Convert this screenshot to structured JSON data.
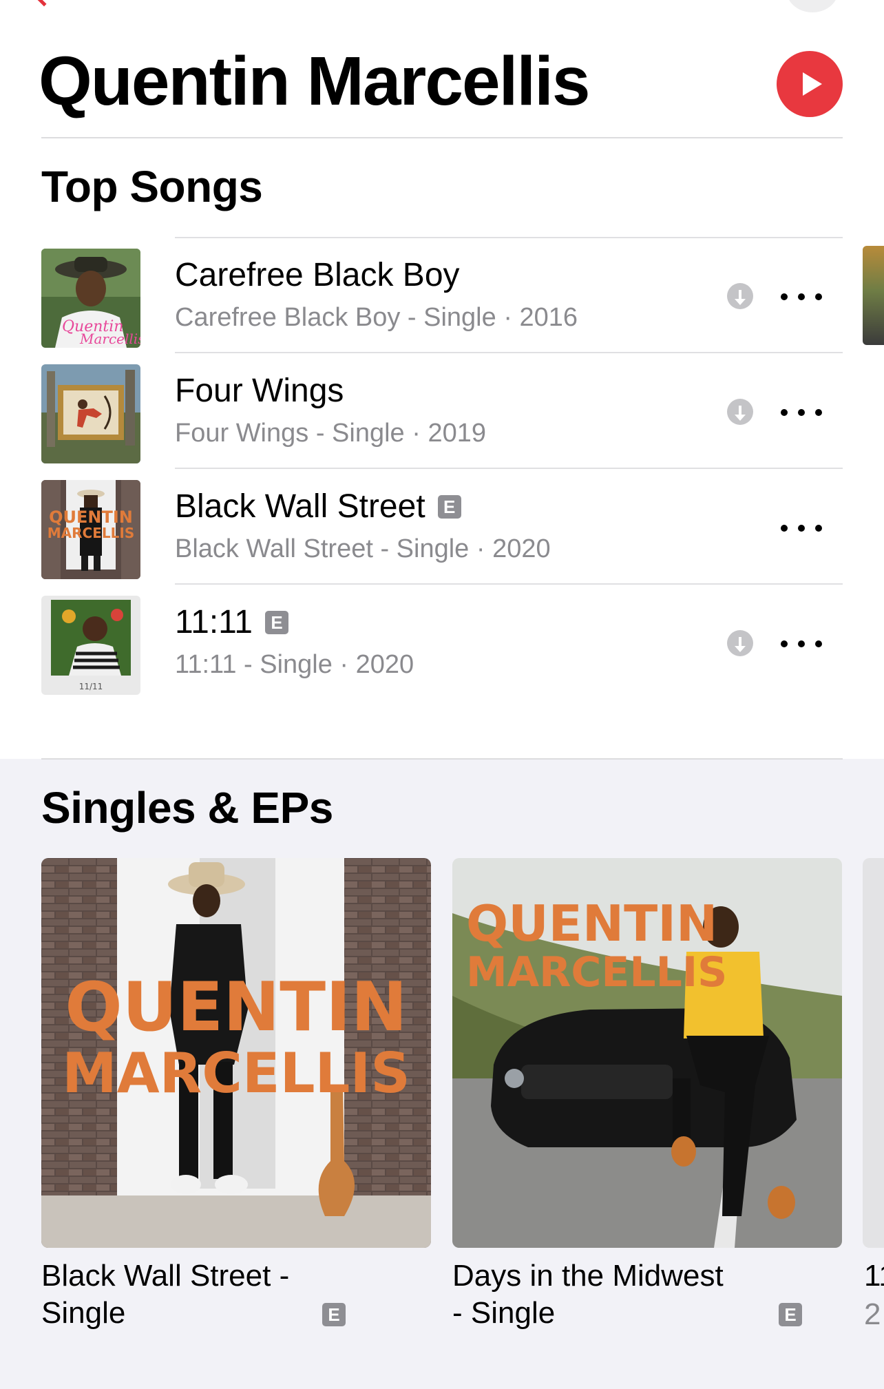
{
  "header": {
    "artist_name": "Quentin Marcellis"
  },
  "top_songs": {
    "title": "Top Songs",
    "items": [
      {
        "title": "Carefree Black Boy",
        "subtitle": "Carefree Black Boy - Single · 2016",
        "explicit": false,
        "explicit_label": "",
        "downloadable": true
      },
      {
        "title": "Four Wings",
        "subtitle": "Four Wings - Single · 2019",
        "explicit": false,
        "explicit_label": "",
        "downloadable": true
      },
      {
        "title": "Black Wall Street",
        "subtitle": "Black Wall Street - Single · 2020",
        "explicit": true,
        "explicit_label": "E",
        "downloadable": false
      },
      {
        "title": "11:11",
        "subtitle": "11:11 - Single · 2020",
        "explicit": true,
        "explicit_label": "E",
        "downloadable": true
      }
    ]
  },
  "singles": {
    "title": "Singles & EPs",
    "items": [
      {
        "title": "Black Wall Street - Single",
        "explicit_label": "E",
        "art_text_line1": "QUENTIN",
        "art_text_line2": "MARCELLIS"
      },
      {
        "title": "Days in the Midwest - Single",
        "explicit_label": "E",
        "art_text_line1": "QUENTIN",
        "art_text_line2": "MARCELLIS"
      }
    ],
    "peek_title": "11",
    "peek_subtitle": "2"
  },
  "thumbs": {
    "song3_art_line1": "QUENTIN",
    "song3_art_line2": "MARCELLIS",
    "song4_art_caption": "11/11"
  },
  "colors": {
    "accent": "#e8383f",
    "secondary_text": "#8a8a8e",
    "explicit_badge": "#8e8e93",
    "section_bg": "#f2f2f7"
  }
}
